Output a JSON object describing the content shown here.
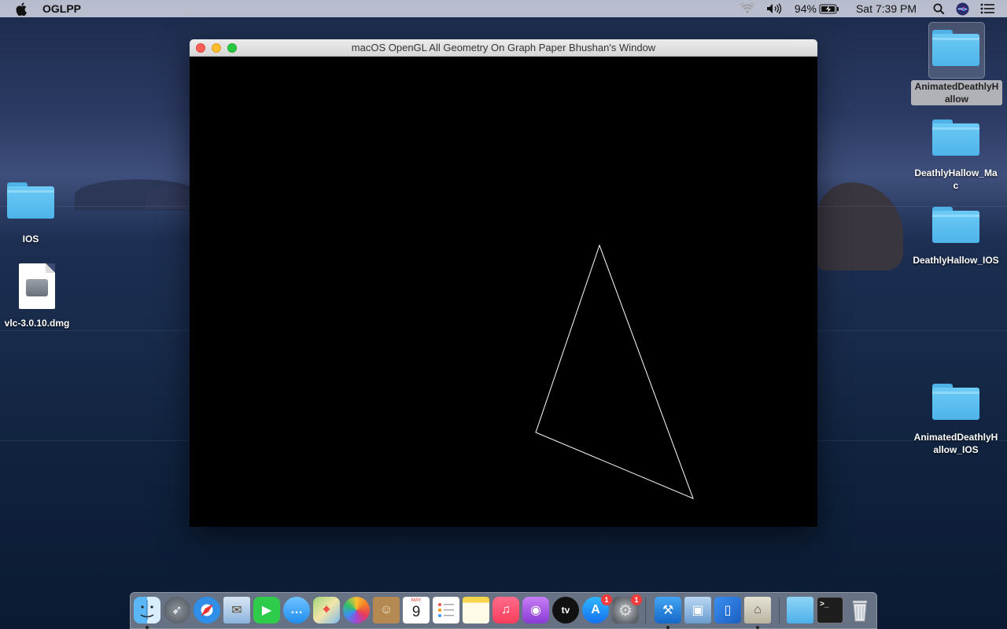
{
  "menubar": {
    "app_name": "OGLPP",
    "battery_percent": "94%",
    "clock": "Sat 7:39 PM"
  },
  "window": {
    "title": "macOS OpenGL All Geometry On Graph Paper Bhushan's Window"
  },
  "gl_scene": {
    "shape": "triangle",
    "stroke_color": "#ffffff",
    "background_color": "#000000"
  },
  "desktop": {
    "left_icons": [
      {
        "label": "IOS",
        "kind": "folder"
      },
      {
        "label": "vlc-3.0.10.dmg",
        "kind": "disk-image"
      }
    ],
    "right_icons": [
      {
        "label": "AnimatedDeathlyHallow",
        "kind": "folder",
        "selected": true
      },
      {
        "label": "DeathlyHallow_Mac",
        "kind": "folder"
      },
      {
        "label": "DeathlyHallow_IOS",
        "kind": "folder"
      },
      {
        "label": "AnimatedDeathlyHallow_IOS",
        "kind": "folder"
      }
    ]
  },
  "dock": {
    "apps": [
      {
        "name": "finder-icon",
        "running": true
      },
      {
        "name": "launchpad-icon"
      },
      {
        "name": "safari-icon"
      },
      {
        "name": "mail-icon"
      },
      {
        "name": "facetime-icon"
      },
      {
        "name": "messages-icon"
      },
      {
        "name": "maps-icon"
      },
      {
        "name": "photos-icon"
      },
      {
        "name": "contacts-icon"
      },
      {
        "name": "calendar-icon",
        "month": "MAY",
        "day": "9"
      },
      {
        "name": "reminders-icon"
      },
      {
        "name": "notes-icon"
      },
      {
        "name": "music-icon"
      },
      {
        "name": "podcasts-icon"
      },
      {
        "name": "tv-icon",
        "label": "tv"
      },
      {
        "name": "app-store-icon",
        "badge": "1"
      },
      {
        "name": "system-preferences-icon",
        "badge": "1"
      },
      {
        "name": "xcode-icon",
        "running": true
      },
      {
        "name": "preview-icon"
      },
      {
        "name": "simulator-icon"
      },
      {
        "name": "instruments-icon",
        "running": true
      },
      {
        "name": "downloads-folder-icon"
      },
      {
        "name": "terminal-icon"
      },
      {
        "name": "trash-icon"
      }
    ]
  }
}
